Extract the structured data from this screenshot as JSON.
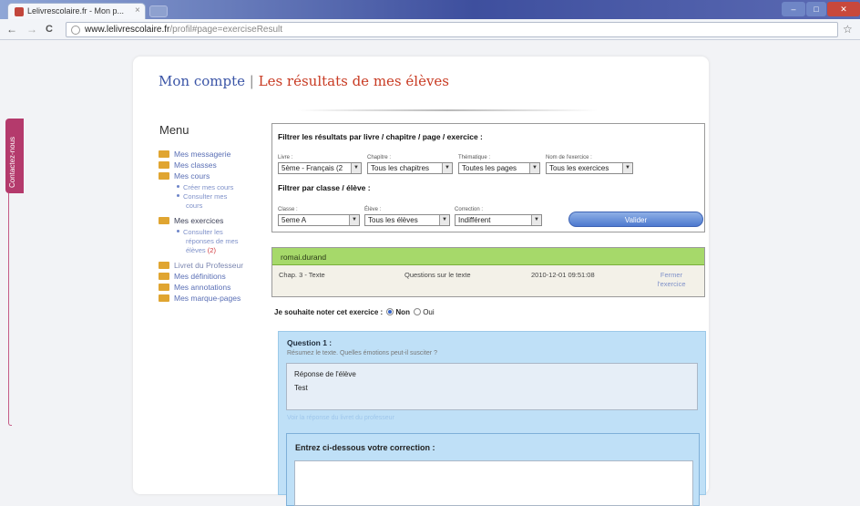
{
  "browser": {
    "tab_title": "Lelivrescolaire.fr - Mon p...",
    "tab_close": "×",
    "url_host": "www.lelivrescolaire.fr",
    "url_path": "/profil#page=exerciseResult",
    "back": "←",
    "forward": "→",
    "reload": "C",
    "star": "☆",
    "window_buttons": {
      "minimize": "–",
      "maximize": "□",
      "close": "✕"
    }
  },
  "side_tab": {
    "label": "Contactez-nous"
  },
  "page": {
    "heading_left": "Mon compte",
    "heading_sep": "|",
    "heading_right": "Les résultats de mes élèves"
  },
  "menu": {
    "title": "Menu",
    "items": [
      {
        "label": "Mes messagerie"
      },
      {
        "label": "Mes classes"
      },
      {
        "label": "Mes cours"
      },
      {
        "label": "Mes exercices"
      },
      {
        "label": "Livret du Professeur"
      },
      {
        "label": "Mes définitions"
      },
      {
        "label": "Mes annotations"
      },
      {
        "label": "Mes marque-pages"
      }
    ],
    "sub_cours": [
      "Créer mes cours",
      "Consulter mes",
      "cours"
    ],
    "sub_exercices": [
      "Consulter les",
      "réponses de mes",
      "élèves",
      "(2)"
    ]
  },
  "filters": {
    "heading1": "Filtrer les résultats par livre / chapitre / page / exercice :",
    "heading2": "Filtrer par classe / élève :",
    "livre": {
      "label": "Livre :",
      "value": "5ème - Français (2"
    },
    "chapitre": {
      "label": "Chapitre :",
      "value": "Tous les chapitres"
    },
    "thematique": {
      "label": "Thématique :",
      "value": "Toutes les pages"
    },
    "exercice": {
      "label": "Nom de l'exercice :",
      "value": "Tous les exercices"
    },
    "classe": {
      "label": "Classe :",
      "value": "5eme A"
    },
    "eleve": {
      "label": "Élève :",
      "value": "Tous les élèves"
    },
    "correction": {
      "label": "Correction :",
      "value": "Indifférent"
    },
    "submit": "Valider",
    "arrow": "▼"
  },
  "result": {
    "student": "romai.durand",
    "chapter": "Chap. 3 - Texte",
    "exercise": "Questions sur le texte",
    "date": "2010-12-01 09:51:08",
    "close_line1": "Fermer",
    "close_line2": "l'exercice"
  },
  "rating": {
    "question": "Je souhaite noter cet exercice :",
    "option_no": "Non",
    "option_yes": "Oui",
    "selected": "Non"
  },
  "question": {
    "title": "Question 1 :",
    "text": "Résumez le texte. Quelles émotions peut-il susciter ?",
    "answer_label": "Réponse de l'élève",
    "answer_value": "Test",
    "teacher_link": "Voir la réponse du livret du professeur",
    "correction_title": "Entrez ci-dessous votre correction :",
    "correction_value": ""
  },
  "colors": {
    "heading_blue": "#3a54a6",
    "heading_red": "#c83a22",
    "green_bar": "#a6d96a",
    "question_bg": "#bfe0f7",
    "contact_tab": "#b43a6c"
  }
}
